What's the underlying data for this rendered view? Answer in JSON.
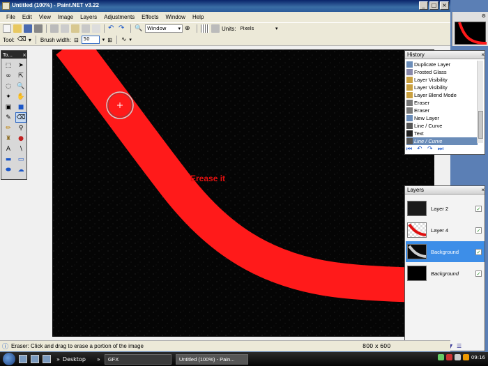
{
  "window": {
    "title": "Untitled (100%) - Paint.NET v3.22",
    "controls": [
      "_",
      "□",
      "×"
    ]
  },
  "menu": [
    "File",
    "Edit",
    "View",
    "Image",
    "Layers",
    "Adjustments",
    "Effects",
    "Window",
    "Help"
  ],
  "toolbar": {
    "zoom_dropdown": "Window",
    "units_label": "Units:",
    "units_value": "Pixels"
  },
  "tool_options": {
    "tool_label": "Tool:",
    "brush_width_label": "Brush width:",
    "brush_width_value": "50"
  },
  "tools_panel": {
    "title": "To..."
  },
  "canvas": {
    "text": "Erease it",
    "stroke_color": "#ff1a1a",
    "background": "#050505"
  },
  "history": {
    "title": "History",
    "items": [
      {
        "label": "Duplicate Layer",
        "icon": "duplicate-layer-icon"
      },
      {
        "label": "Frosted Glass",
        "icon": "frosted-glass-icon"
      },
      {
        "label": "Layer Visibility",
        "icon": "layer-visibility-icon"
      },
      {
        "label": "Layer Visibility",
        "icon": "layer-visibility-icon"
      },
      {
        "label": "Layer Blend Mode",
        "icon": "layer-blend-mode-icon"
      },
      {
        "label": "Eraser",
        "icon": "eraser-icon"
      },
      {
        "label": "Eraser",
        "icon": "eraser-icon"
      },
      {
        "label": "New Layer",
        "icon": "new-layer-icon"
      },
      {
        "label": "Line / Curve",
        "icon": "line-curve-icon"
      },
      {
        "label": "Text",
        "icon": "text-icon"
      },
      {
        "label": "Line / Curve",
        "icon": "line-curve-icon",
        "greyed": true
      }
    ]
  },
  "layers": {
    "title": "Layers",
    "items": [
      {
        "name": "Layer 2",
        "visible": true
      },
      {
        "name": "Layer 4",
        "visible": true
      },
      {
        "name": "Background",
        "visible": true,
        "selected": true
      },
      {
        "name": "Background",
        "visible": true,
        "italic": true
      }
    ]
  },
  "status": {
    "message": "Eraser: Click and drag to erase a portion of the image",
    "dimensions": "800 x 600"
  },
  "taskbar": {
    "desktop": "Desktop",
    "gfx": "GFX",
    "app": "Untitled (100%) - Pain...",
    "clock": "09:16"
  }
}
